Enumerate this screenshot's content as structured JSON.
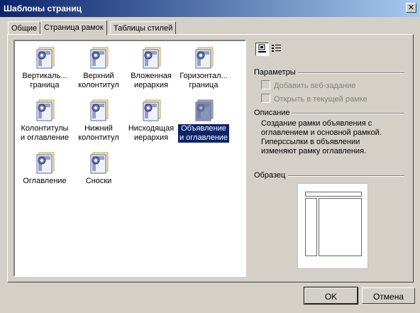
{
  "window": {
    "title": "Шаблоны страниц"
  },
  "tabs": [
    {
      "label": "Общие"
    },
    {
      "label": "Страница рамок"
    },
    {
      "label": "Таблицы стилей"
    }
  ],
  "templates": [
    {
      "line1": "Вертикаль...",
      "line2": "граница"
    },
    {
      "line1": "Верхний",
      "line2": "колонтитул"
    },
    {
      "line1": "Вложенная",
      "line2": "иерархия"
    },
    {
      "line1": "Горизонтал...",
      "line2": "граница"
    },
    {
      "line1": "Колонтитулы",
      "line2": "и оглавление"
    },
    {
      "line1": "Нижний",
      "line2": "колонтитул"
    },
    {
      "line1": "Нисходящая",
      "line2": "иерархия"
    },
    {
      "line1": "Объявление",
      "line2": "и оглавление"
    },
    {
      "line1": "Оглавление",
      "line2": ""
    },
    {
      "line1": "Сноски",
      "line2": ""
    }
  ],
  "selected_template": "Объявление и оглавление",
  "view_buttons": [
    {
      "icon": "large-icons-view-icon",
      "pressed": true
    },
    {
      "icon": "list-view-icon",
      "pressed": false
    }
  ],
  "params": {
    "title": "Параметры",
    "add_web_task": "Добавить веб-задание",
    "open_in_frame": "Открыть в текущей рамке"
  },
  "description": {
    "title": "Описание",
    "line1": "Создание рамки объявления с",
    "line2": "оглавлением и основной рамкой.",
    "line3": "Гиперссылки в объявлении",
    "line4": "изменяют рамку оглавления."
  },
  "sample": {
    "title": "Образец"
  },
  "buttons": {
    "ok": "OK",
    "cancel": "Отмена"
  }
}
